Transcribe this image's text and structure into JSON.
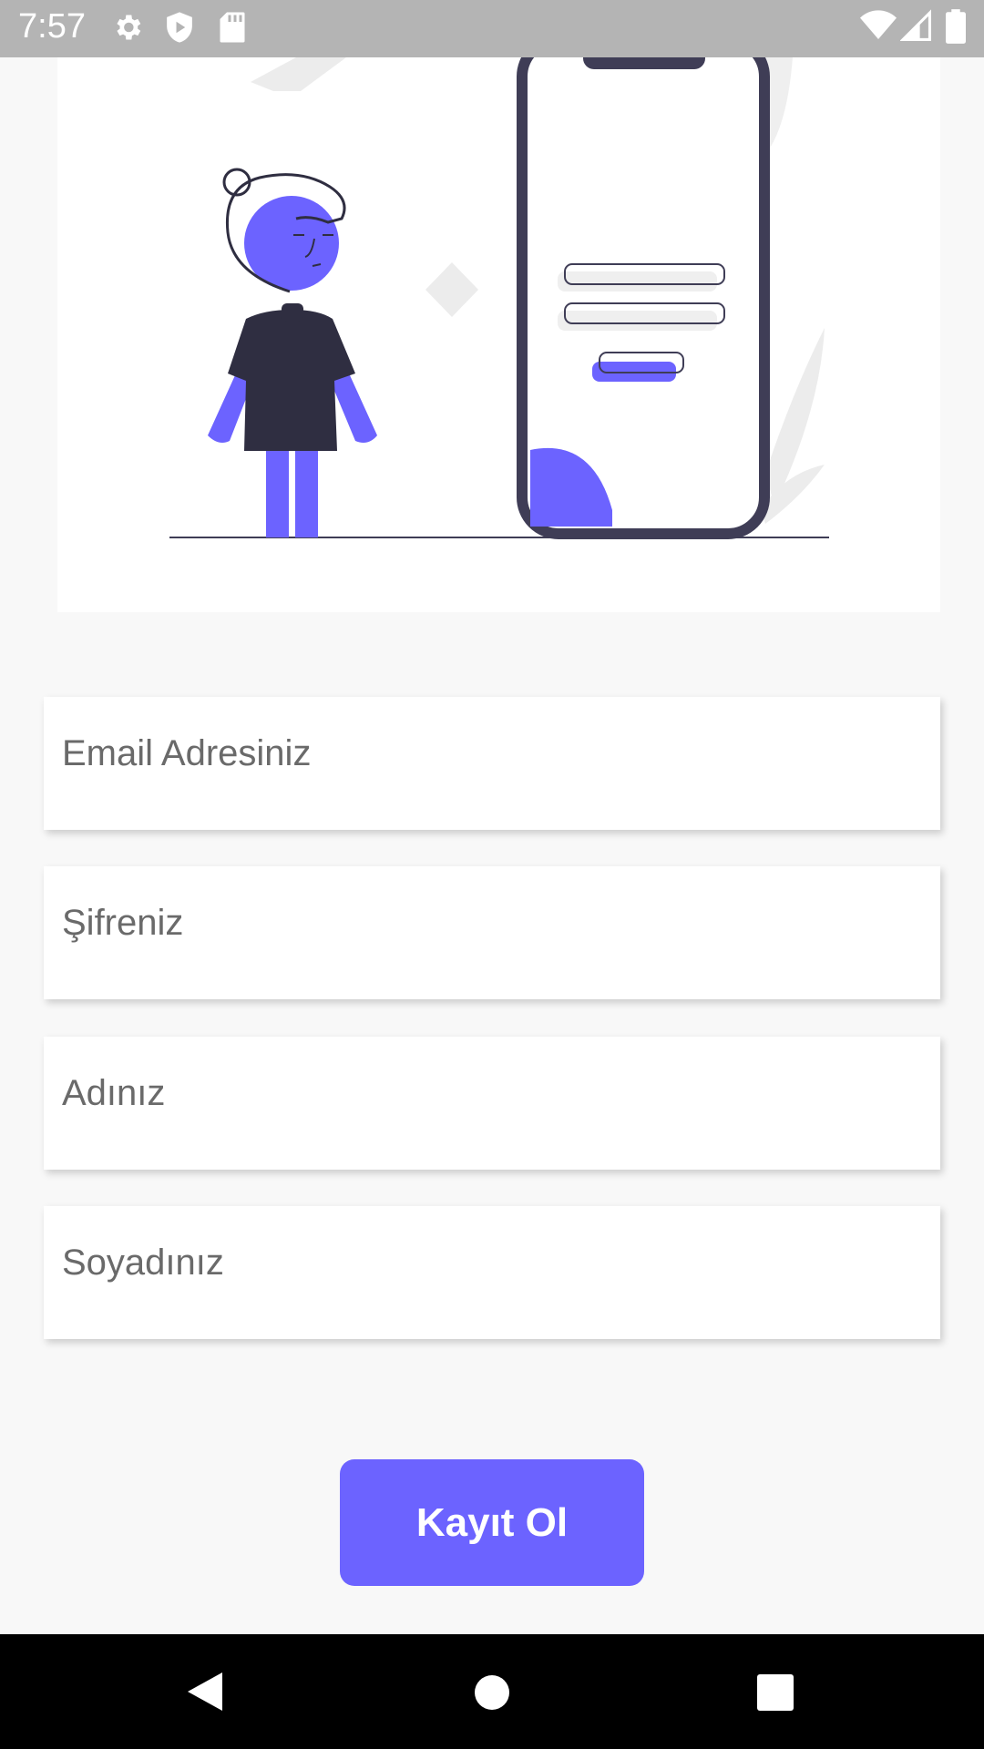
{
  "status_bar": {
    "time": "7:57",
    "left_icons": [
      "gear-icon",
      "shield-play-icon",
      "sd-card-icon"
    ],
    "right_icons": [
      "wifi-icon",
      "signal-icon",
      "battery-icon"
    ]
  },
  "illustration": {
    "description_icon": "person-with-phone-login-illustration",
    "accent_color": "#6c63ff",
    "dark_color": "#2f2e41"
  },
  "form": {
    "email_placeholder": "Email Adresiniz",
    "password_placeholder": "Şifreniz",
    "name_placeholder": "Adınız",
    "surname_placeholder": "Soyadınız"
  },
  "register_button": {
    "label": "Kayıt Ol",
    "color": "#6c63ff"
  },
  "navigation_bar": {
    "buttons": [
      "back-icon",
      "home-icon",
      "recents-icon"
    ]
  }
}
